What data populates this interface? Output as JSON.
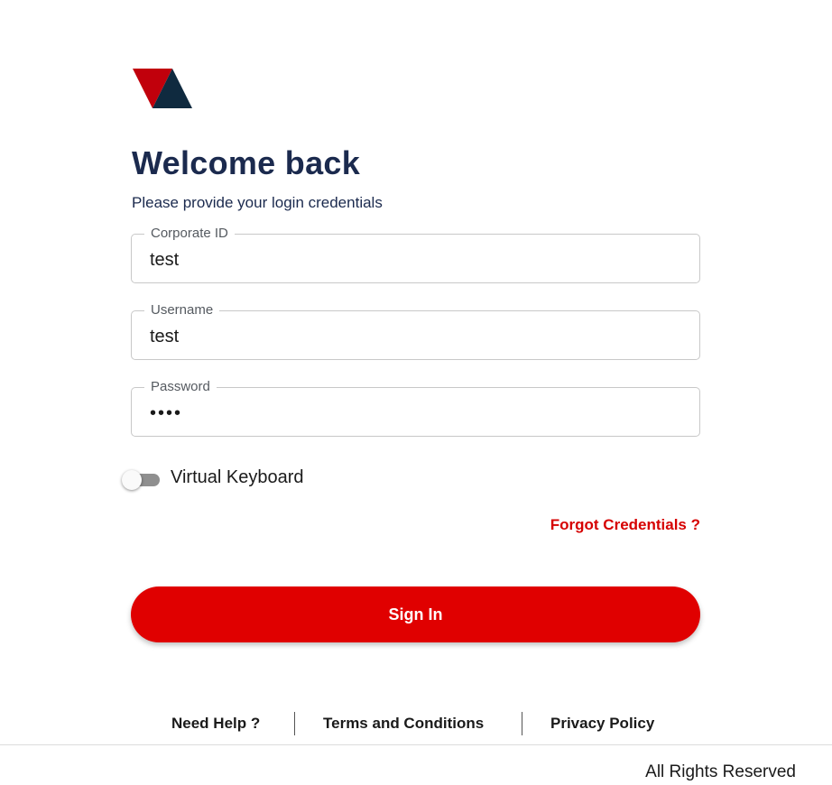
{
  "login": {
    "title": "Welcome back",
    "subtitle": "Please provide your login credentials",
    "fields": [
      {
        "label": "Corporate ID",
        "value": "test"
      },
      {
        "label": "Username",
        "value": "test"
      },
      {
        "label": "Password",
        "value": "••••"
      }
    ],
    "virtual_keyboard": {
      "label": "Virtual Keyboard",
      "enabled": false
    },
    "forgot_label": "Forgot Credentials ?",
    "signin_label": "Sign In"
  },
  "footer": {
    "links": [
      "Need Help ?",
      "Terms and Conditions",
      "Privacy Policy"
    ],
    "rights": "All Rights Reserved"
  },
  "colors": {
    "accent": "#e00000",
    "brand_dark": "#1b2a4e"
  },
  "icons": {
    "logo": "brand-logo-triangles"
  }
}
